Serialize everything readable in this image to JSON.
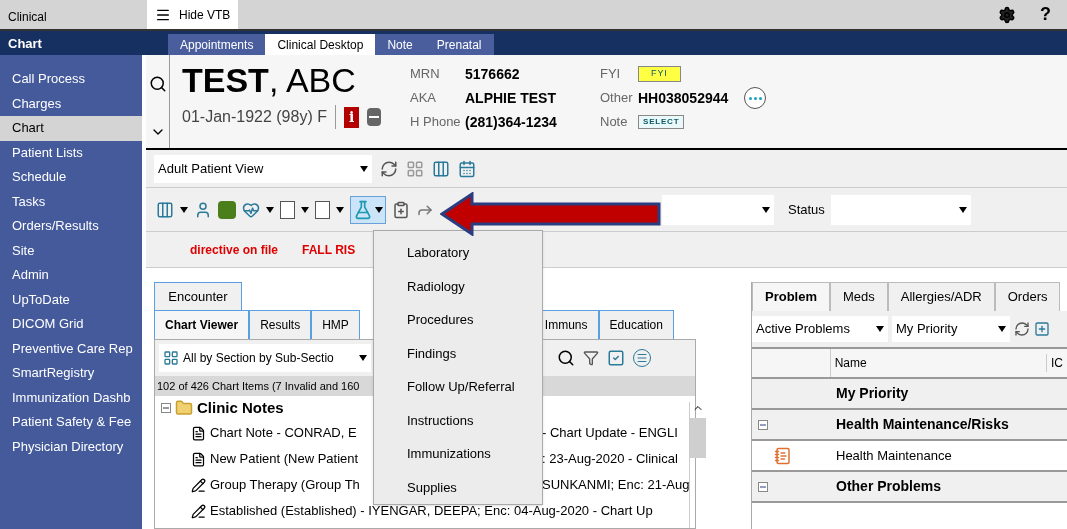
{
  "app_bar": {
    "section": "Clinical",
    "toggle": "Hide VTB",
    "help": "?"
  },
  "nav_bar": {
    "title": "Chart",
    "tabs": [
      {
        "label": "Appointments",
        "selected": false
      },
      {
        "label": "Clinical Desktop",
        "selected": true
      },
      {
        "label": "Note",
        "selected": false
      },
      {
        "label": "Prenatal",
        "selected": false
      }
    ]
  },
  "sidebar": {
    "items": [
      {
        "label": "Call Process",
        "selected": false
      },
      {
        "label": "Charges",
        "selected": false
      },
      {
        "label": "Chart",
        "selected": true
      },
      {
        "label": "Patient Lists",
        "selected": false
      },
      {
        "label": "Schedule",
        "selected": false
      },
      {
        "label": "Tasks",
        "selected": false
      },
      {
        "label": "Orders/Results",
        "selected": false
      },
      {
        "label": "Site",
        "selected": false
      },
      {
        "label": "Admin",
        "selected": false
      },
      {
        "label": "UpToDate",
        "selected": false
      },
      {
        "label": "DICOM Grid",
        "selected": false
      },
      {
        "label": "Preventive Care Rep",
        "selected": false
      },
      {
        "label": "SmartRegistry",
        "selected": false
      },
      {
        "label": "Immunization Dashb",
        "selected": false
      },
      {
        "label": "Patient Safety & Fee",
        "selected": false
      },
      {
        "label": "Physician Directory",
        "selected": false
      }
    ]
  },
  "patient": {
    "name": "**TEST**, ABC",
    "demographics": "01-Jan-1922 (98y) F",
    "info_badge": "i",
    "fields_left": [
      {
        "label": "MRN",
        "value": "5176662"
      },
      {
        "label": "AKA",
        "value": "ALPHIE TEST"
      },
      {
        "label": "H Phone",
        "value": "(281)364-1234"
      }
    ],
    "fields_right": [
      {
        "label": "FYI",
        "kind": "tag",
        "value": "FYI"
      },
      {
        "label": "Other",
        "kind": "text",
        "value": "HH038052944"
      },
      {
        "label": "Note",
        "kind": "select",
        "value": "SELECT"
      }
    ]
  },
  "view_select": {
    "value": "Adult Patient View"
  },
  "status_filter": {
    "label": "Status"
  },
  "alerts": [
    "directive on file",
    "FALL RIS"
  ],
  "order_menu": {
    "items": [
      "Laboratory",
      "Radiology",
      "Procedures",
      "Findings",
      "Follow Up/Referral",
      "Instructions",
      "Immunizations",
      "Supplies"
    ]
  },
  "chart_viewer": {
    "top_tab": "Encounter",
    "tabs": [
      {
        "label": "Chart Viewer",
        "selected": true
      },
      {
        "label": "Results",
        "selected": false
      },
      {
        "label": "HMP",
        "selected": false
      },
      {
        "label": "Immuns",
        "selected": false
      },
      {
        "label": "Education",
        "selected": false
      }
    ],
    "filter": "All by Section by Sub-Sectio",
    "count": "102 of 426 Chart Items (7 Invalid and 160",
    "section": {
      "label": "Clinic Notes",
      "expanded": true
    },
    "rows": [
      {
        "kind": "note",
        "left": "Chart Note - CONRAD, E",
        "right": "- Chart Update - ENGLI"
      },
      {
        "kind": "note",
        "left": "New Patient (New Patient",
        "right": ": 23-Aug-2020 - Clinical"
      },
      {
        "kind": "edit",
        "left": "Group Therapy (Group Th",
        "right": "SUNKANMI; Enc: 21-Aug"
      },
      {
        "kind": "edit",
        "left": "Established (Established) - IYENGAR, DEEPA; Enc: 04-Aug-2020 - Chart Up"
      }
    ]
  },
  "problems": {
    "tabs": [
      {
        "label": "Problem",
        "selected": true
      },
      {
        "label": "Meds",
        "selected": false
      },
      {
        "label": "Allergies/ADR",
        "selected": false
      },
      {
        "label": "Orders",
        "selected": false
      }
    ],
    "list_select": "Active Problems",
    "sort_select": "My Priority",
    "columns": [
      "Name",
      "IC"
    ],
    "rows": [
      {
        "kind": "group",
        "label": "My Priority",
        "toggle": false
      },
      {
        "kind": "group",
        "label": "Health Maintenance/Risks",
        "toggle": true
      },
      {
        "kind": "item",
        "label": "Health Maintenance"
      },
      {
        "kind": "group",
        "label": "Other Problems",
        "toggle": true
      }
    ]
  }
}
